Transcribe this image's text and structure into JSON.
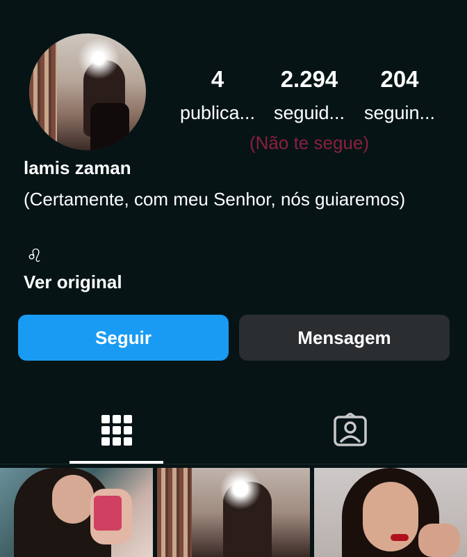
{
  "profile": {
    "name": "lamis zaman",
    "bio": "(Certamente, com meu Senhor, nós guiaremos)",
    "zodiac": "♌︎",
    "see_original": "Ver original"
  },
  "stats": {
    "posts": {
      "value": "4",
      "label": "publica..."
    },
    "followers": {
      "value": "2.294",
      "label": "seguid..."
    },
    "following": {
      "value": "204",
      "label": "seguin..."
    },
    "not_following_note": "(Não te segue)"
  },
  "actions": {
    "follow_label": "Seguir",
    "message_label": "Mensagem"
  },
  "tabs": [
    {
      "icon": "grid-icon",
      "active": true
    },
    {
      "icon": "tagged-person-icon",
      "active": false
    }
  ],
  "posts": [
    {
      "name": "post-thumbnail-1"
    },
    {
      "name": "post-thumbnail-2"
    },
    {
      "name": "post-thumbnail-3"
    }
  ],
  "colors": {
    "background": "#061416",
    "follow_button": "#1a9bf3",
    "message_button": "#2a2e30",
    "not_following_text": "#8a1f3e"
  }
}
